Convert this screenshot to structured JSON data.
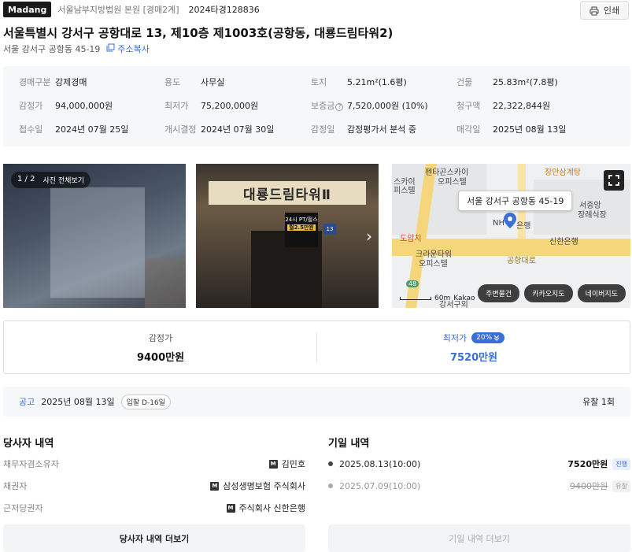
{
  "header": {
    "brand": "Madang",
    "court": "서울남부지방법원 본원 [경매2계]",
    "case_no": "2024타경128836",
    "print_label": "인쇄"
  },
  "property": {
    "title": "서울특별시 강서구 공항대로 13, 제10층 제1003호(공항동, 대룡드림타워2)",
    "short_address": "서울 강서구 공항동 45-19",
    "copy_label": "주소복사"
  },
  "info": {
    "row1": [
      {
        "label": "경매구분",
        "value": "강제경매"
      },
      {
        "label": "용도",
        "value": "사무실"
      },
      {
        "label": "토지",
        "value": "5.21m²(1.6평)"
      },
      {
        "label": "건물",
        "value": "25.83m²(7.8평)"
      }
    ],
    "row2": [
      {
        "label": "감정가",
        "value": "94,000,000원"
      },
      {
        "label": "최저가",
        "value": "75,200,000원"
      },
      {
        "label": "보증금",
        "value": "7,520,000원 (10%)"
      },
      {
        "label": "청구액",
        "value": "22,322,844원"
      }
    ],
    "row3": [
      {
        "label": "접수일",
        "value": "2024년 07월 25일"
      },
      {
        "label": "개시결정",
        "value": "2024년 07월 30일"
      },
      {
        "label": "감정일",
        "value": "감정평가서 분석 중"
      },
      {
        "label": "매각일",
        "value": "2025년 08월 13일"
      }
    ]
  },
  "photos": {
    "counter": "1 / 2",
    "view_all": "사진 전체보기",
    "sign_text": "대룡드림타워Ⅱ",
    "banner_line1": "24시 PT/필스",
    "banner_line2": "월2.5만원",
    "building_no": "13"
  },
  "map": {
    "tooltip": "서울 강서구 공항동 45-19",
    "labels": {
      "a": "펜타곤스카이",
      "b": "오피스텔",
      "c": "장안삼계탕",
      "d": "스카이",
      "e": "피스텔",
      "f": "서중앙",
      "g": "장례식장",
      "h": "NH",
      "i": "은행",
      "j": "신한은행",
      "k": "도암치",
      "l": "크라운타워",
      "m": "오피스텔",
      "n": "공항대로",
      "o": "48",
      "p": "강서구외"
    },
    "scale": "60m",
    "provider": "Kakao",
    "buttons": [
      "주변물건",
      "카카오지도",
      "네이버지도"
    ]
  },
  "price": {
    "appraisal_label": "감정가",
    "appraisal_value": "9400만원",
    "min_label": "최저가",
    "min_pct": "20%",
    "min_value": "7520만원"
  },
  "notice": {
    "label": "공고",
    "date": "2025년 08월 13일",
    "dday": "입찰 D-16일",
    "fail": "유찰 1회"
  },
  "parties": {
    "title": "당사자 내역",
    "rows": [
      {
        "label": "채무자겸소유자",
        "value": "김민호"
      },
      {
        "label": "채권자",
        "value": "삼성생명보험 주식회사"
      },
      {
        "label": "근저당권자",
        "value": "주식회사 신한은행"
      }
    ],
    "badge": "M",
    "more": "당사자 내역 더보기"
  },
  "dates": {
    "title": "기일 내역",
    "rows": [
      {
        "date": "2025.08.13(10:00)",
        "price": "7520만원",
        "status": "진행"
      },
      {
        "date": "2025.07.09(10:00)",
        "price": "9400만원",
        "status": "유찰"
      }
    ],
    "more": "기일 내역 더보기"
  }
}
